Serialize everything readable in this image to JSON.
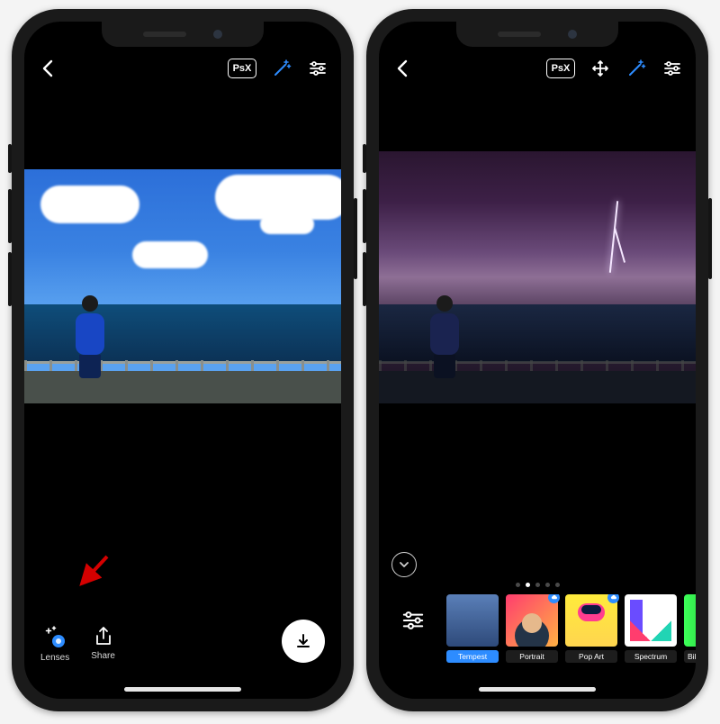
{
  "accent": "#2d8cff",
  "left": {
    "topbar": {
      "back": "Back",
      "psx": "PsX",
      "magic": "Auto",
      "adjust": "Adjust"
    },
    "bottom": {
      "lenses_label": "Lenses",
      "share_label": "Share",
      "download": "Download"
    }
  },
  "right": {
    "topbar": {
      "back": "Back",
      "psx": "PsX",
      "move": "Move",
      "magic": "Auto",
      "adjust": "Adjust"
    },
    "pager": {
      "count": 5,
      "active_index": 1
    },
    "collapse": "Collapse",
    "filters": [
      {
        "id": "adjust",
        "label": "",
        "selected": false,
        "cloud": false,
        "thumb": "adjust"
      },
      {
        "id": "tempest",
        "label": "Tempest",
        "selected": true,
        "cloud": false,
        "thumb": "tempest"
      },
      {
        "id": "portrait",
        "label": "Portrait",
        "selected": false,
        "cloud": true,
        "thumb": "portrait"
      },
      {
        "id": "popart",
        "label": "Pop Art",
        "selected": false,
        "cloud": true,
        "thumb": "popart"
      },
      {
        "id": "spectrum",
        "label": "Spectrum",
        "selected": false,
        "cloud": false,
        "thumb": "spectrum"
      },
      {
        "id": "billie",
        "label": "Billie Eilish Bl…",
        "selected": false,
        "cloud": true,
        "thumb": "billie"
      }
    ]
  }
}
